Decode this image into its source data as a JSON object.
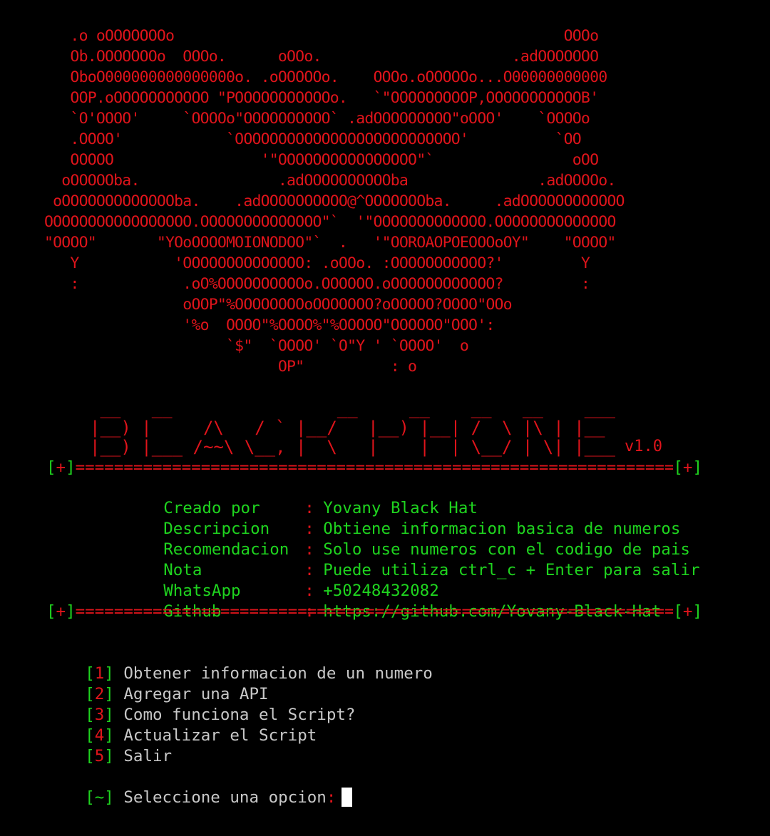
{
  "ascii_art": "   .o oOOOOOOOo                                             OOOo\n   Ob.OOOOOOOo  OOOo.      oOOo.                      .adOOOOOOO\n   OboO000000000000000o. .oOOOOOo.    OOOo.oOOOOOo...O00000000000\n   OOP.oOOOOOOOOOOO \"POOOOOOOOOOOo.   `\"OOOOOOOOOP,OOOOOOOOOOOB'\n   `O'OOOO'     `OOOOo\"OOOOOOOOOO` .adOOOOOOOOO\"oOOO'    `OOOOo\n   .OOOO'            `OOOOOOOOOOOOOOOOOOOOOOOOOO'          `OO\n   OOOOO                 '\"OOOOOOOOOOOOOOOO\"`                oOO\n  oOOOOOba.                .adOOOOOOOOOOba               .adOOOOo.\n oOOOOOOOOOOOOOba.    .adOOOOOOOOOO@^OOOOOOOba.     .adOOOOOOOOOOOO\nOOOOOOOOOOOOOOOOO.OOOOOOOOOOOOOO\"`  '\"OOOOOOOOOOOOO.OOOOOOOOOOOOOO\n\"OOOO\"       \"YOoOOOOMOIONODOO\"`  .   '\"OOROAOPOEOOOoOY\"    \"OOOO\"\n   Y           'OOOOOOOOOOOOOO: .oOOo. :OOOOOOOOOOO?'         Y\n   :            .oO%OOOOOOOOOOo.OOOOOO.oOOOOOOOOOOOO?         :\n                oOOP\"%OOOOOOOOoOOOOOOO?oOOOOO?OOOO\"OOo\n                '%o  OOOO\"%OOOO%\"%OOOOO\"OOOOOO\"OOO':\n                     `$\"  `OOOO' `O\"Y ' `OOOO'  o\n                           OP\"          : o",
  "banner_art": " __   __                __     __    __   __    ___\n|__) |     /\\   / ` |__/   |__) |__| /  \\ |\\ | |__\n|__) |___ /~~\\ \\__, |  \\   |    |  | \\__/ | \\| |___",
  "version": "v1.0",
  "separator": {
    "marker": "+",
    "fill": "================================================================================================"
  },
  "info": [
    {
      "key": "Creado por",
      "value": "Yovany Black Hat"
    },
    {
      "key": "Descripcion",
      "value": "Obtiene informacion basica de numeros"
    },
    {
      "key": "Recomendacion",
      "value": "Solo use numeros con el codigo de pais"
    },
    {
      "key": "Nota",
      "value": "Puede utiliza ctrl_c + Enter para salir"
    },
    {
      "key": "WhatsApp",
      "value": "+50248432082"
    },
    {
      "key": "Github",
      "value": "https://github.com/Yovany-Black-Hat"
    }
  ],
  "menu": [
    {
      "num": "1",
      "label": "Obtener informacion de un numero"
    },
    {
      "num": "2",
      "label": "Agregar una API"
    },
    {
      "num": "3",
      "label": "Como funciona el Script?"
    },
    {
      "num": "4",
      "label": "Actualizar el Script"
    },
    {
      "num": "5",
      "label": "Salir"
    }
  ],
  "prompt": {
    "marker": "~",
    "label": "Seleccione una opcion",
    "colon": ":"
  },
  "colors": {
    "background": "#000000",
    "red": "#e0141b",
    "green": "#1fd41f",
    "gray": "#c8c8c8"
  }
}
